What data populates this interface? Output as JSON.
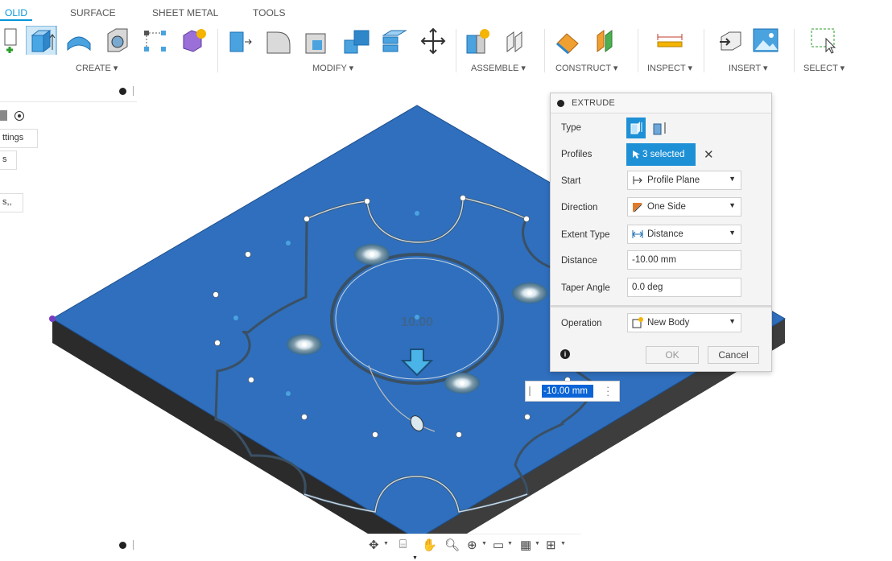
{
  "tabs": [
    {
      "label": "OLID",
      "active": true
    },
    {
      "label": "SURFACE",
      "active": false
    },
    {
      "label": "SHEET METAL",
      "active": false
    },
    {
      "label": "TOOLS",
      "active": false
    }
  ],
  "toolbar": {
    "groups": {
      "create": "CREATE ▾",
      "modify": "MODIFY ▾",
      "assemble": "ASSEMBLE ▾",
      "construct": "CONSTRUCT ▾",
      "inspect": "INSPECT ▾",
      "insert": "INSERT ▾",
      "select": "SELECT ▾"
    },
    "accent": "#0696d7"
  },
  "browser": {
    "rows": [
      "ttings",
      "s",
      "s,,"
    ]
  },
  "viewport": {
    "sketch_dimension": "10.00",
    "plate_color": "#2f6fbd"
  },
  "extrude": {
    "title": "EXTRUDE",
    "labels": {
      "type": "Type",
      "profiles": "Profiles",
      "start": "Start",
      "direction": "Direction",
      "extent_type": "Extent Type",
      "distance": "Distance",
      "taper_angle": "Taper Angle",
      "operation": "Operation"
    },
    "values": {
      "profiles": "3 selected",
      "start": "Profile Plane",
      "direction": "One Side",
      "extent_type": "Distance",
      "distance": "-10.00 mm",
      "taper_angle": "0.0 deg",
      "operation": "New Body"
    },
    "buttons": {
      "ok": "OK",
      "cancel": "Cancel"
    }
  },
  "float_input": {
    "value": "-10.00 mm"
  }
}
